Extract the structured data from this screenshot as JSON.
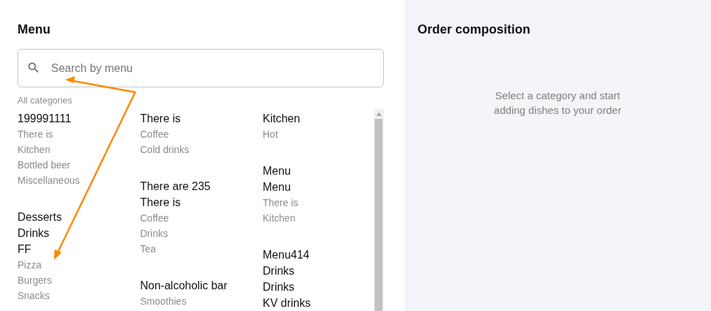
{
  "menu": {
    "title": "Menu",
    "search": {
      "placeholder": "Search by menu"
    },
    "all_categories": "All categories",
    "columns": [
      [
        [
          {
            "text": "199991111",
            "kind": "category"
          },
          {
            "text": "There is",
            "kind": "subcategory"
          },
          {
            "text": "Kitchen",
            "kind": "subcategory"
          },
          {
            "text": "Bottled beer",
            "kind": "subcategory"
          },
          {
            "text": "Miscellaneous",
            "kind": "subcategory"
          }
        ],
        [
          {
            "text": "Desserts",
            "kind": "category"
          },
          {
            "text": "Drinks",
            "kind": "category"
          },
          {
            "text": "FF",
            "kind": "category"
          },
          {
            "text": "Pizza",
            "kind": "subcategory"
          },
          {
            "text": "Burgers",
            "kind": "subcategory"
          },
          {
            "text": "Snacks",
            "kind": "subcategory"
          }
        ]
      ],
      [
        [
          {
            "text": "There is",
            "kind": "category"
          },
          {
            "text": "Coffee",
            "kind": "subcategory"
          },
          {
            "text": "Cold drinks",
            "kind": "subcategory"
          }
        ],
        [
          {
            "text": "There are 235",
            "kind": "category"
          },
          {
            "text": "There is",
            "kind": "category"
          },
          {
            "text": "Coffee",
            "kind": "subcategory"
          },
          {
            "text": "Drinks",
            "kind": "subcategory"
          },
          {
            "text": "Tea",
            "kind": "subcategory"
          }
        ],
        [
          {
            "text": "Non-alcoholic bar",
            "kind": "category"
          },
          {
            "text": "Smoothies",
            "kind": "subcategory"
          }
        ]
      ],
      [
        [
          {
            "text": "Kitchen",
            "kind": "category"
          },
          {
            "text": "Hot",
            "kind": "subcategory"
          }
        ],
        [
          {
            "text": "Menu",
            "kind": "category"
          },
          {
            "text": "Menu",
            "kind": "category"
          },
          {
            "text": "There is",
            "kind": "subcategory"
          },
          {
            "text": "Kitchen",
            "kind": "subcategory"
          }
        ],
        [
          {
            "text": "Menu414",
            "kind": "category"
          },
          {
            "text": "Drinks",
            "kind": "category"
          },
          {
            "text": "Drinks",
            "kind": "category"
          },
          {
            "text": "KV drinks",
            "kind": "category"
          }
        ]
      ]
    ]
  },
  "order": {
    "title": "Order composition",
    "empty_message": "Select a category and start adding dishes to your order"
  }
}
